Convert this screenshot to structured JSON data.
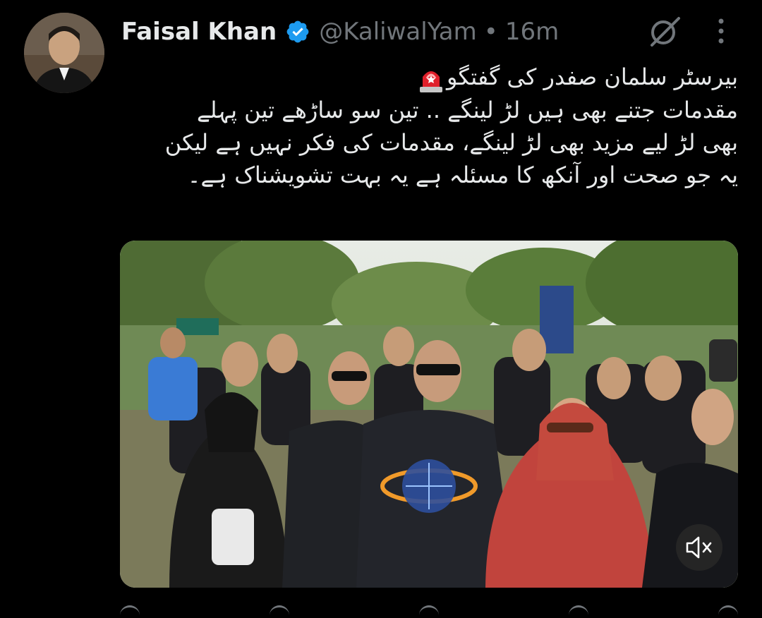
{
  "user": {
    "name": "Faisal Khan",
    "handle": "@KaliwalYam",
    "separator": "•",
    "time": "16m",
    "verified_color": "#1d9bf0"
  },
  "tweet": {
    "lines": [
      "بیرسٹر سلمان صفدر کی گفتگو",
      "مقدمات جتنے بھی ہیں لڑ لینگے .. تین سو ساڑھے تین پہلے",
      "بھی لڑ لیے مزید بھی لڑ لینگے، مقدمات کی فکر نہیں ہے لیکن",
      "یہ جو صحت اور آنکھ کا مسئلہ ہے یہ بہت تشویشناک ہے۔"
    ],
    "emoji": "siren-icon"
  },
  "media": {
    "type": "video",
    "muted": true
  },
  "icons": {
    "grok": "grok-icon",
    "more": "more-icon",
    "mute": "speaker-muted-icon"
  },
  "colors": {
    "background": "#000000",
    "text": "#e7e9ea",
    "secondary": "#71767b",
    "accent": "#1d9bf0"
  }
}
